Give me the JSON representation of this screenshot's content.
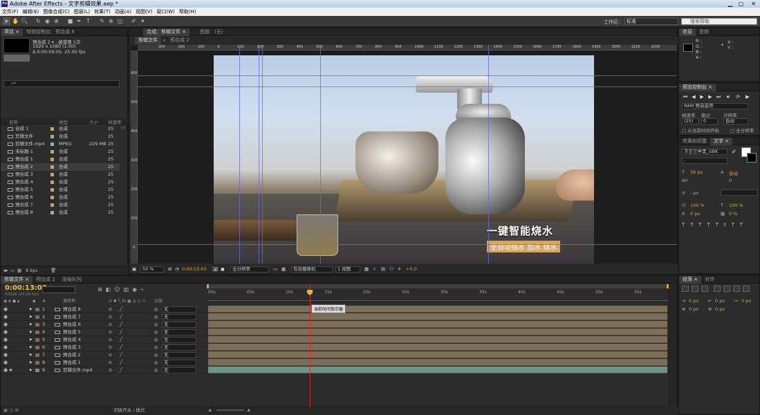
{
  "window": {
    "title": "Adobe After Effects - 文字剪辑效果.aep *",
    "app_icon": "Ae"
  },
  "menu": [
    "文件(F)",
    "编辑(E)",
    "图像合成(C)",
    "图层(L)",
    "效果(T)",
    "动画(A)",
    "视图(V)",
    "窗口(W)",
    "帮助(H)"
  ],
  "toolbar": {
    "workspace_label": "工作区：",
    "workspace_value": "标准",
    "search_placeholder": "搜索帮助"
  },
  "project": {
    "tabs": [
      "项目 ×",
      "特效控制台：预合成 8"
    ],
    "selected_name": "预合成 2 ▾  , 被使用 1次",
    "selected_res": "1920 x 1080 (1.00)",
    "selected_dur": "Δ 0:00:59:05, 25.00 fps",
    "search_placeholder": "ρ▾",
    "columns": {
      "name": "名称",
      "type": "类型",
      "size": "大小",
      "fps": "帧速率"
    },
    "items": [
      {
        "name": "合成 1",
        "type": "合成",
        "size": "",
        "fps": "25",
        "color": "#c9a469"
      },
      {
        "name": "剪辑文件",
        "type": "合成",
        "size": "",
        "fps": "25",
        "color": "#c9a469"
      },
      {
        "name": "剪辑文件.mp4",
        "type": "MPEG",
        "size": "229 MB",
        "fps": "25",
        "color": "#8fb0c9"
      },
      {
        "name": "未标题-1",
        "type": "合成",
        "size": "",
        "fps": "25",
        "color": "#c9a469"
      },
      {
        "name": "预合成 1",
        "type": "合成",
        "size": "",
        "fps": "25",
        "color": "#c9a469"
      },
      {
        "name": "预合成 2",
        "type": "合成",
        "size": "",
        "fps": "25",
        "color": "#c9a469"
      },
      {
        "name": "预合成 3",
        "type": "合成",
        "size": "",
        "fps": "25",
        "color": "#c9a469"
      },
      {
        "name": "预合成 4",
        "type": "合成",
        "size": "",
        "fps": "25",
        "color": "#c9a469"
      },
      {
        "name": "预合成 5",
        "type": "合成",
        "size": "",
        "fps": "25",
        "color": "#c9a469"
      },
      {
        "name": "预合成 6",
        "type": "合成",
        "size": "",
        "fps": "25",
        "color": "#c9a469"
      },
      {
        "name": "预合成 7",
        "type": "合成",
        "size": "",
        "fps": "25",
        "color": "#c9a469"
      },
      {
        "name": "预合成 8",
        "type": "合成",
        "size": "",
        "fps": "25",
        "color": "#c9a469"
      }
    ],
    "bpc": "8 bpc"
  },
  "composition": {
    "tabs": [
      "合成：剪辑文件 ×",
      "图层：(无)"
    ],
    "subtabs": [
      "剪辑文件",
      "预合成 2"
    ],
    "ruler_top": [
      "300",
      "200",
      "100",
      "0",
      "100",
      "200",
      "300",
      "400",
      "500",
      "600",
      "700",
      "800",
      "900",
      "1000",
      "1100",
      "1200",
      "1300",
      "1400",
      "1500",
      "1600",
      "1700",
      "1800",
      "1900",
      "2000",
      "2100",
      "2200"
    ],
    "ruler_left": [
      "600",
      "500",
      "400",
      "300",
      "200",
      "100",
      "0"
    ],
    "caption_main": "一键智能烧水",
    "caption_sub": "全自动抽水 加水 烧水",
    "footer": {
      "zoom": "50 %",
      "timecode": "0:00:13:03",
      "resolution": "全分辨率",
      "camera": "有效摄像机",
      "views": "1 视图",
      "exposure": "+0.0"
    }
  },
  "info": {
    "tabs": [
      "信息",
      "音频"
    ],
    "r": "R :",
    "g": "G :",
    "b": "B :",
    "a": "A :",
    "x": "X :",
    "y": "Y :"
  },
  "preview": {
    "tab": "预览控制台 ×",
    "ram": "RAM 预演选项",
    "fps_label": "帧速率",
    "skip_label": "跳过",
    "res_label": "分辨率",
    "fps_value": "(25)",
    "skip_value": "0",
    "res_value": "自动",
    "from_current": "从当前时间开始",
    "fullscreen": "全分辨率"
  },
  "effects": {
    "tabs": [
      "效果和预置",
      "文字 ×"
    ],
    "font": "方正兰亭黑_GBK",
    "style": "-",
    "size": "36 px",
    "leading": "自动",
    "kerning": "0",
    "stroke": "- px",
    "vscale": "100 %",
    "hscale": "100 %",
    "baseline": "0 px",
    "tsume": "0 %",
    "styles": [
      "T",
      "T",
      "TT",
      "Tt",
      "T",
      "T",
      "T"
    ]
  },
  "timeline": {
    "tabs": [
      "剪辑文件 ×",
      "预合成 2",
      "渲染队列"
    ],
    "timecode": "0:00:13:03",
    "timecode_sub": "00328 (25.00 fps)",
    "col_name": "源名称",
    "col_parent": "父级",
    "ticks": [
      "00s",
      "05s",
      "10s",
      "15s",
      "20s",
      "25s",
      "30s",
      "35s",
      "40s",
      "45s",
      "50s",
      "55s"
    ],
    "cti_tooltip": "当前时间指示器",
    "layers": [
      {
        "num": "1",
        "name": "预合成 8",
        "parent": "无"
      },
      {
        "num": "2",
        "name": "预合成 7",
        "parent": "无"
      },
      {
        "num": "3",
        "name": "预合成 6",
        "parent": "无"
      },
      {
        "num": "4",
        "name": "预合成 5",
        "parent": "无"
      },
      {
        "num": "5",
        "name": "预合成 4",
        "parent": "无"
      },
      {
        "num": "6",
        "name": "预合成 3",
        "parent": "无"
      },
      {
        "num": "7",
        "name": "预合成 2",
        "parent": "无"
      },
      {
        "num": "8",
        "name": "预合成 1",
        "parent": "无"
      },
      {
        "num": "9",
        "name": "剪辑文件.mp4",
        "parent": "无"
      }
    ],
    "footer": "切换开关 / 模式"
  },
  "paragraph": {
    "tabs": [
      "段落 ×",
      "对齐"
    ],
    "indent_left": "0 px",
    "indent_right": "0 px",
    "indent_first": "0 px",
    "space_before": "0 px",
    "space_after": "0 px"
  },
  "colors": {
    "accent": "#e0a33e",
    "timecode": "#e7c74c",
    "layer_bar": "#7c6e58",
    "video_bar": "#6e918a",
    "guide": "#6b6bd6",
    "cti": "#d02a2a"
  }
}
